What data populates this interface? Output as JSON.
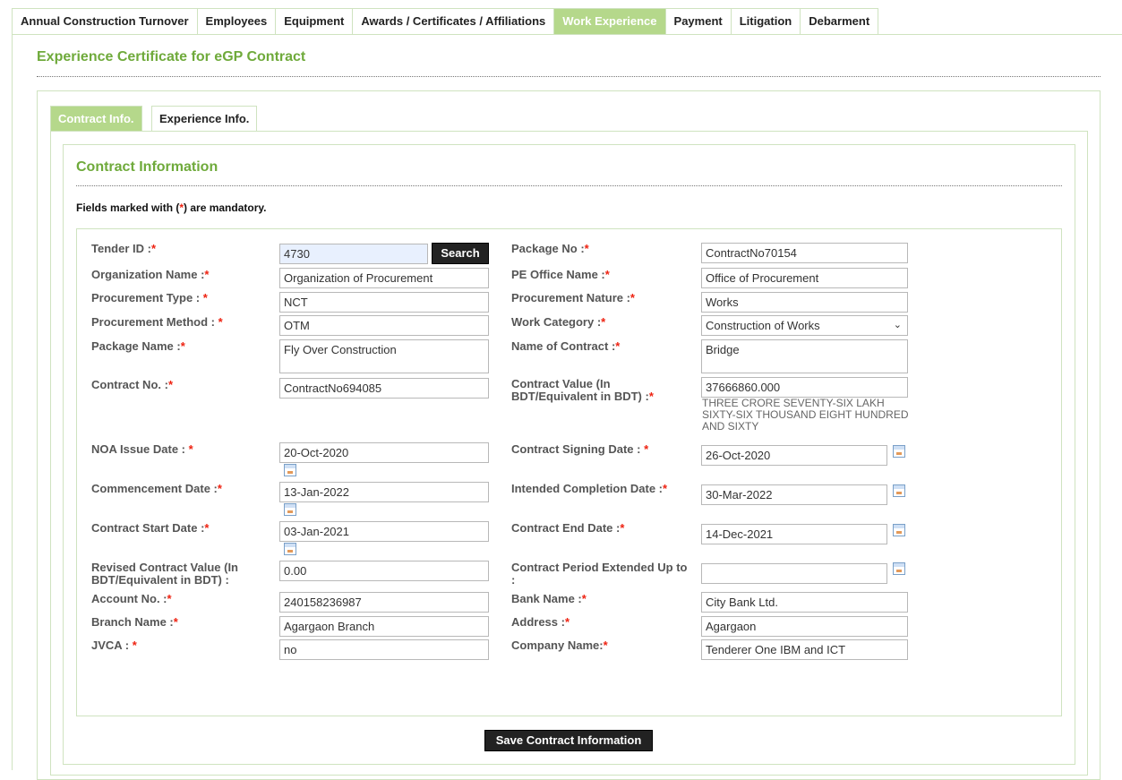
{
  "top_tabs": [
    "Annual Construction Turnover",
    "Employees",
    "Equipment",
    "Awards / Certificates / Affiliations",
    "Work Experience",
    "Payment",
    "Litigation",
    "Debarment"
  ],
  "page_title": "Experience Certificate for eGP Contract",
  "sub_tabs": [
    "Contract Info.",
    "Experience Info."
  ],
  "section_title": "Contract Information",
  "mandatory_note": {
    "prefix": "Fields marked with (",
    "star": "*",
    "suffix": ") are mandatory."
  },
  "left_fields": [
    {
      "label": "Tender ID :",
      "value": "4730"
    },
    {
      "label": "Organization Name :",
      "value": "Organization of Procurement"
    },
    {
      "label": "Procurement Type : ",
      "value": "NCT"
    },
    {
      "label": "Procurement Method : ",
      "value": "OTM"
    },
    {
      "label": "Package Name :",
      "value": "Fly Over Construction"
    },
    {
      "label": "Contract No. :",
      "value": "ContractNo694085"
    },
    {
      "label": "NOA Issue Date : ",
      "value": "20-Oct-2020"
    },
    {
      "label": "Commencement Date :",
      "value": "13-Jan-2022"
    },
    {
      "label": "Contract Start Date :",
      "value": "03-Jan-2021"
    },
    {
      "label_line1": "Revised Contract Value (In",
      "label_line2": "BDT/Equivalent in BDT) :",
      "value": "0.00"
    },
    {
      "label": "Account No. :",
      "value": "240158236987"
    },
    {
      "label": "Branch Name :",
      "value": "Agargaon Branch"
    },
    {
      "label": "JVCA : ",
      "value": "no"
    }
  ],
  "right_fields": [
    {
      "label": "Package No :",
      "value": "ContractNo70154"
    },
    {
      "label": "PE Office Name :",
      "value": "Office of Procurement"
    },
    {
      "label": "Procurement Nature :",
      "value": "Works"
    },
    {
      "label": "Work Category :",
      "value": "Construction of Works"
    },
    {
      "label": "Name of Contract :",
      "value": "Bridge"
    },
    {
      "label_line1": "Contract Value (In",
      "label_line2": "BDT/Equivalent in BDT) :",
      "value": "37666860.000",
      "words": "THREE CRORE SEVENTY-SIX LAKH SIXTY-SIX THOUSAND EIGHT HUNDRED AND SIXTY"
    },
    {
      "label": "Contract Signing Date : ",
      "value": "26-Oct-2020"
    },
    {
      "label": "Intended Completion Date :",
      "value": "30-Mar-2022"
    },
    {
      "label": "Contract End Date :",
      "value": "14-Dec-2021"
    },
    {
      "label_line1": "Contract Period Extended Up to",
      "label_line2": ":",
      "value": ""
    },
    {
      "label": "Bank Name :",
      "value": "City Bank Ltd."
    },
    {
      "label": "Address :",
      "value": "Agargaon"
    },
    {
      "label": "Company Name:",
      "value": "Tenderer One IBM and ICT"
    }
  ],
  "star": "*",
  "search_label": "Search",
  "save_label": "Save Contract Information",
  "colors": {
    "accent": "#6faa3b",
    "active_tab": "#b5d88b",
    "border": "#cfe3c0",
    "required": "#e21"
  },
  "icons": [
    "calendar-icon",
    "chevron-down-icon"
  ]
}
